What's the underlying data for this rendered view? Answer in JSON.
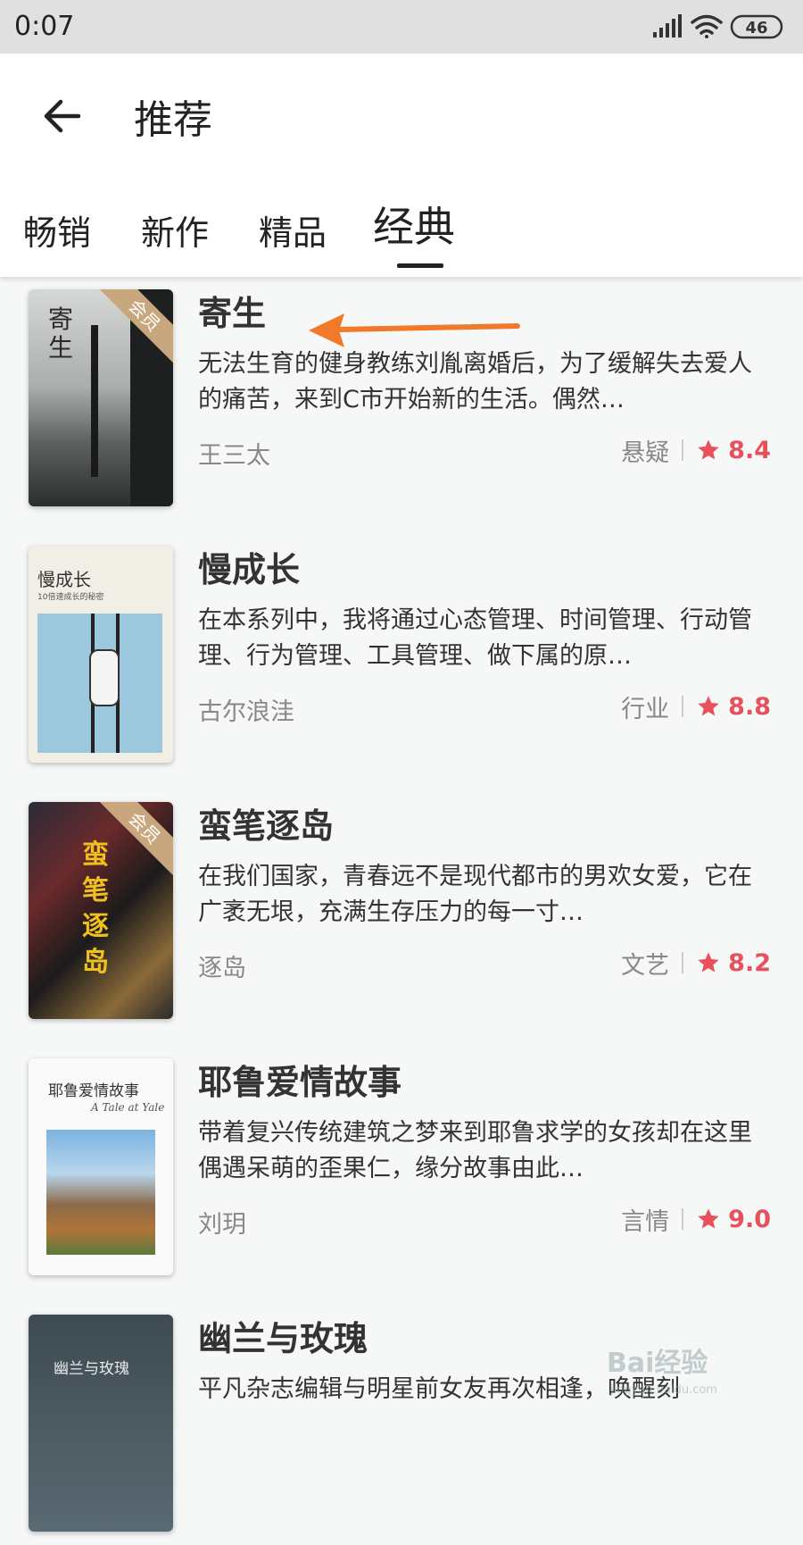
{
  "status_bar": {
    "time": "0:07",
    "battery": "46"
  },
  "header": {
    "title": "推荐"
  },
  "tabs": [
    {
      "label": "畅销"
    },
    {
      "label": "新作"
    },
    {
      "label": "精品"
    },
    {
      "label": "经典",
      "active": true
    }
  ],
  "books": [
    {
      "title": "寄生",
      "description": "无法生育的健身教练刘胤离婚后，为了缓解失去爱人的痛苦，来到C市开始新的生活。偶然…",
      "author": "王三太",
      "genre": "悬疑",
      "rating": "8.4",
      "vip_label": "会员",
      "cover_text": "寄生"
    },
    {
      "title": "慢成长",
      "description": "在本系列中，我将通过心态管理、时间管理、行动管理、行为管理、工具管理、做下属的原…",
      "author": "古尔浪洼",
      "genre": "行业",
      "rating": "8.8",
      "cover_text": "慢成长",
      "cover_subtext": "10倍速成长的秘密"
    },
    {
      "title": "蛮笔逐岛",
      "description": "在我们国家，青春远不是现代都市的男欢女爱，它在广袤无垠，充满生存压力的每一寸…",
      "author": "逐岛",
      "genre": "文艺",
      "rating": "8.2",
      "vip_label": "会员",
      "cover_text": "蛮笔逐岛"
    },
    {
      "title": "耶鲁爱情故事",
      "description": "带着复兴传统建筑之梦来到耶鲁求学的女孩却在这里偶遇呆萌的歪果仁，缘分故事由此…",
      "author": "刘玥",
      "genre": "言情",
      "rating": "9.0",
      "cover_text": "耶鲁爱情故事",
      "cover_subtext": "A Tale at Yale"
    },
    {
      "title": "幽兰与玫瑰",
      "description": "平凡杂志编辑与明星前女友再次相逢，唤醒刻",
      "cover_text": "幽兰与玫瑰"
    }
  ],
  "watermark": {
    "text": "Bai经验",
    "sub": "jingyan.baidu.com"
  },
  "colors": {
    "accent_rating": "#e8505b",
    "annotation_arrow": "#f07a2a",
    "vip_ribbon": "#c8a77e"
  }
}
